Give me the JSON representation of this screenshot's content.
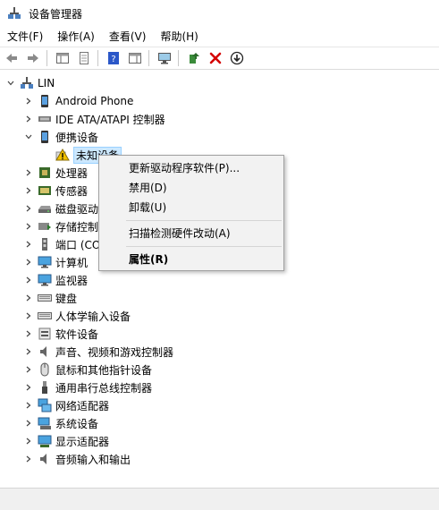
{
  "window": {
    "title": "设备管理器"
  },
  "menu": [
    "文件(F)",
    "操作(A)",
    "查看(V)",
    "帮助(H)"
  ],
  "tree": {
    "root": "LIN",
    "items": [
      {
        "label": "Android Phone",
        "icon": "phone-icon"
      },
      {
        "label": "IDE ATA/ATAPI 控制器",
        "icon": "ide-controller-icon"
      },
      {
        "label": "便携设备",
        "icon": "portable-device-icon",
        "expanded": true
      },
      {
        "label": "未知设备",
        "icon": "warning-icon",
        "child": true,
        "selected": true
      },
      {
        "label": "处理器",
        "icon": "processor-icon"
      },
      {
        "label": "传感器",
        "icon": "sensor-icon"
      },
      {
        "label": "磁盘驱动器",
        "icon": "disk-icon"
      },
      {
        "label": "存储控制器",
        "icon": "storage-controller-icon"
      },
      {
        "label": "端口 (COM 和 LPT)",
        "icon": "port-icon"
      },
      {
        "label": "计算机",
        "icon": "computer-icon"
      },
      {
        "label": "监视器",
        "icon": "monitor-icon"
      },
      {
        "label": "键盘",
        "icon": "keyboard-icon"
      },
      {
        "label": "人体学输入设备",
        "icon": "hid-icon"
      },
      {
        "label": "软件设备",
        "icon": "software-device-icon"
      },
      {
        "label": "声音、视频和游戏控制器",
        "icon": "speaker-icon"
      },
      {
        "label": "鼠标和其他指针设备",
        "icon": "mouse-icon"
      },
      {
        "label": "通用串行总线控制器",
        "icon": "usb-icon"
      },
      {
        "label": "网络适配器",
        "icon": "network-icon"
      },
      {
        "label": "系统设备",
        "icon": "system-device-icon"
      },
      {
        "label": "显示适配器",
        "icon": "display-adapter-icon"
      },
      {
        "label": "音频输入和输出",
        "icon": "audio-io-icon"
      }
    ]
  },
  "context_menu": {
    "update_driver": "更新驱动程序软件(P)...",
    "disable": "禁用(D)",
    "uninstall": "卸载(U)",
    "scan": "扫描检测硬件改动(A)",
    "properties": "属性(R)"
  },
  "colors": {
    "selection": "#cce8ff",
    "warning": "#f0c000",
    "delete_red": "#d40000"
  }
}
